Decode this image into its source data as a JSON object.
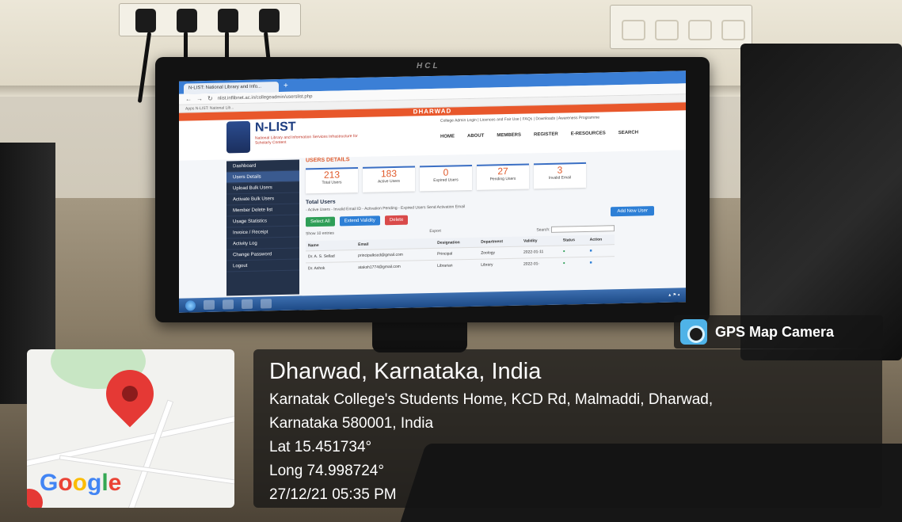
{
  "browser": {
    "tab_title": "N-LIST: National Library and Info...",
    "url": "nlist.inflibnet.ac.in/collegeadmin/userslist.php",
    "bookmarks": "Apps   N-LIST: National Lib..."
  },
  "site": {
    "region": "DHARWAD",
    "logo_title": "N-LIST",
    "logo_subtitle": "National Library and Information Services Infrastructure for Scholarly Content",
    "top_links": "College Admin Login | Licences and Fair Use | FAQs | Downloads | Awareness Programme",
    "nav": [
      "HOME",
      "ABOUT",
      "MEMBERS",
      "REGISTER",
      "E-RESOURCES",
      "SEARCH"
    ]
  },
  "sidebar": {
    "items": [
      {
        "label": "Dashboard",
        "active": false
      },
      {
        "label": "Users Details",
        "active": true
      },
      {
        "label": "Upload Bulk Users",
        "active": false
      },
      {
        "label": "Activate Bulk Users",
        "active": false
      },
      {
        "label": "Member Delete list",
        "active": false
      },
      {
        "label": "Usage Statistics",
        "active": false
      },
      {
        "label": "Invoice / Receipt",
        "active": false
      },
      {
        "label": "Activity Log",
        "active": false
      },
      {
        "label": "Change Password",
        "active": false
      },
      {
        "label": "Logout",
        "active": false
      }
    ]
  },
  "users": {
    "section_title": "USERS DETAILS",
    "stats": [
      {
        "value": "213",
        "label": "Total Users"
      },
      {
        "value": "183",
        "label": "Active Users"
      },
      {
        "value": "0",
        "label": "Expired Users"
      },
      {
        "value": "27",
        "label": "Pending Users"
      },
      {
        "value": "3",
        "label": "Invalid Email"
      }
    ],
    "total_heading": "Total Users",
    "legend": "- Active Users   - Invalid Email ID   - Activation Pending   - Expired Users   Send Activation Email",
    "buttons": {
      "select_all": "Select All",
      "extend": "Extend Validity",
      "delete": "Delete",
      "add_user": "Add New User"
    },
    "show_entries": "Show 10 entries",
    "export": "Export",
    "search_label": "Search:",
    "columns": [
      "Name",
      "Email",
      "Designation",
      "Department",
      "Validity",
      "Status",
      "Action"
    ],
    "rows": [
      [
        "Dr. A. S. Sellad",
        "principalkscd@gmail.com",
        "Principal",
        "Zoology",
        "2022-01-11",
        "",
        ""
      ],
      [
        "Dr. Ashok",
        "ataksh1774@gmail.com",
        "Librarian",
        "Library",
        "2022-01-",
        "",
        ""
      ]
    ]
  },
  "monitor": {
    "brand": "HCL"
  },
  "gps": {
    "badge": "GPS Map Camera",
    "map_logo": "Google",
    "city": "Dharwad, Karnataka, India",
    "address_line1": "Karnatak College's Students Home, KCD Rd, Malmaddi, Dharwad,",
    "address_line2": "Karnataka 580001, India",
    "lat": "Lat 15.451734°",
    "long": "Long 74.998724°",
    "datetime": "27/12/21 05:35 PM"
  }
}
